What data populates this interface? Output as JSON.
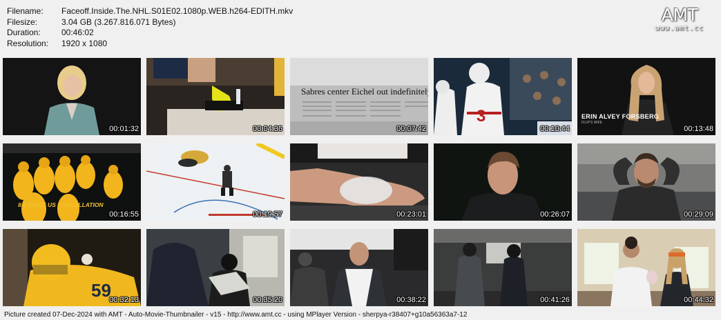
{
  "info": {
    "filename_label": "Filename:",
    "filename": "Faceoff.Inside.The.NHL.S01E02.1080p.WEB.h264-EDITH.mkv",
    "filesize_label": "Filesize:",
    "filesize": "3.04 GB (3.267.816.071 Bytes)",
    "duration_label": "Duration:",
    "duration": "00:46:02",
    "resolution_label": "Resolution:",
    "resolution": "1920 x 1080"
  },
  "logo": {
    "title": "AMT",
    "url": "www.amt.cc"
  },
  "thumbs": [
    {
      "time": "00:01:32"
    },
    {
      "time": "00:04:36"
    },
    {
      "time": "00:07:42",
      "caption": "Sabres center Eichel out indefinitely"
    },
    {
      "time": "00:10:44"
    },
    {
      "time": "00:13:48",
      "caption": "ERIN ALVEY FORSBERG",
      "sub": "FILIP'S WIFE"
    },
    {
      "time": "00:16:55",
      "caption": "8-0 SINCE US CANCELLATION"
    },
    {
      "time": "00:19:57"
    },
    {
      "time": "00:23:01"
    },
    {
      "time": "00:26:07"
    },
    {
      "time": "00:29:09"
    },
    {
      "time": "00:32:13"
    },
    {
      "time": "00:35:20"
    },
    {
      "time": "00:38:22"
    },
    {
      "time": "00:41:26"
    },
    {
      "time": "00:44:32"
    }
  ],
  "footer": "Picture created 07-Dec-2024 with AMT - Auto-Movie-Thumbnailer - v15 - http://www.amt.cc - using MPlayer Version - sherpya-r38407+g10a56363a7-12"
}
